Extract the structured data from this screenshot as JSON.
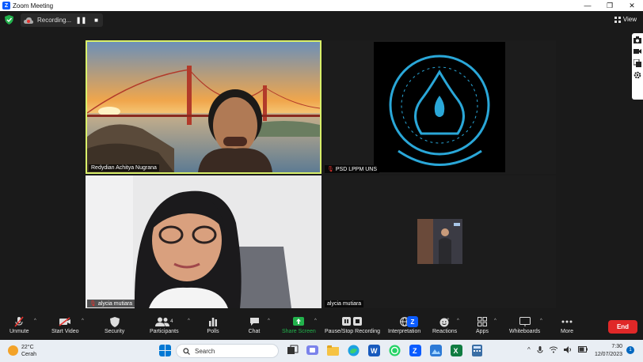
{
  "window": {
    "title": "Zoom Meeting",
    "app_icon": "Z"
  },
  "window_controls": {
    "minimize": "—",
    "restore": "❐",
    "close": "✕"
  },
  "recording": {
    "label": "Recording...",
    "pause": "❚❚",
    "stop": "■"
  },
  "view": {
    "label": "View"
  },
  "participants": [
    {
      "name": "Redydian Achitya Nugrana",
      "muted": false
    },
    {
      "name": "PSD LPPM UNS",
      "muted": true
    },
    {
      "name": "alycia mutiara",
      "muted": true
    },
    {
      "name": "alycia mutiara",
      "muted": false
    }
  ],
  "toolbar": {
    "unmute": "Unmute",
    "start_video": "Start Video",
    "security": "Security",
    "participants": "Participants",
    "participants_count": "4",
    "polls": "Polls",
    "chat": "Chat",
    "share_screen": "Share Screen",
    "pause_recording": "Pause/Stop Recording",
    "interpretation": "Interpretation",
    "reactions": "Reactions",
    "apps": "Apps",
    "whiteboards": "Whiteboards",
    "more": "More",
    "end": "End"
  },
  "colors": {
    "active_speaker": "#d9f06a",
    "end": "#e02828",
    "share": "#22b24c"
  },
  "taskbar": {
    "weather_temp": "22°C",
    "weather_desc": "Cerah",
    "search_placeholder": "Search",
    "time": "7:30",
    "date": "12/07/2023",
    "notifications": "1"
  }
}
